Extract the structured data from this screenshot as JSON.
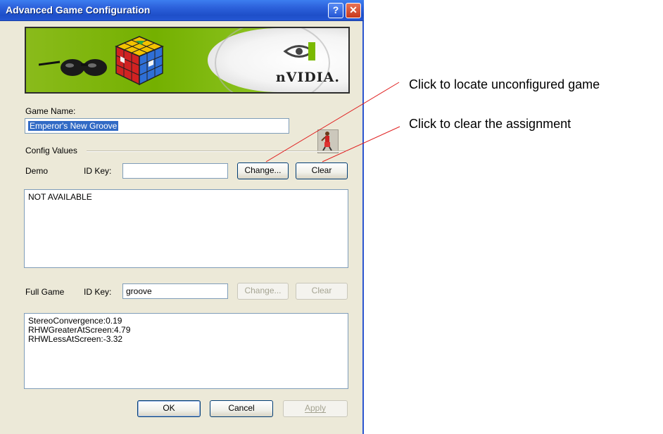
{
  "window": {
    "title": "Advanced Game Configuration",
    "help_glyph": "?",
    "close_glyph": "✕"
  },
  "banner": {
    "brand_text": "nVIDIA."
  },
  "game": {
    "name_label": "Game Name:",
    "name_value": "Emperor's New Groove"
  },
  "config": {
    "group_label": "Config Values",
    "demo": {
      "label": "Demo",
      "id_key_label": "ID Key:",
      "id_key_value": "",
      "change_label": "Change...",
      "clear_label": "Clear",
      "values_text": "NOT AVAILABLE"
    },
    "full": {
      "label": "Full Game",
      "id_key_label": "ID Key:",
      "id_key_value": "groove",
      "change_label": "Change...",
      "clear_label": "Clear",
      "values": [
        "StereoConvergence:0.19",
        "RHWGreaterAtScreen:4.79",
        "RHWLessAtScreen:-3.32"
      ]
    }
  },
  "footer": {
    "ok_label": "OK",
    "cancel_label": "Cancel",
    "apply_label": "Apply"
  },
  "annotations": {
    "locate": "Click to locate unconfigured game",
    "clear": "Click to clear the assignment",
    "line_color": "#e02020"
  }
}
